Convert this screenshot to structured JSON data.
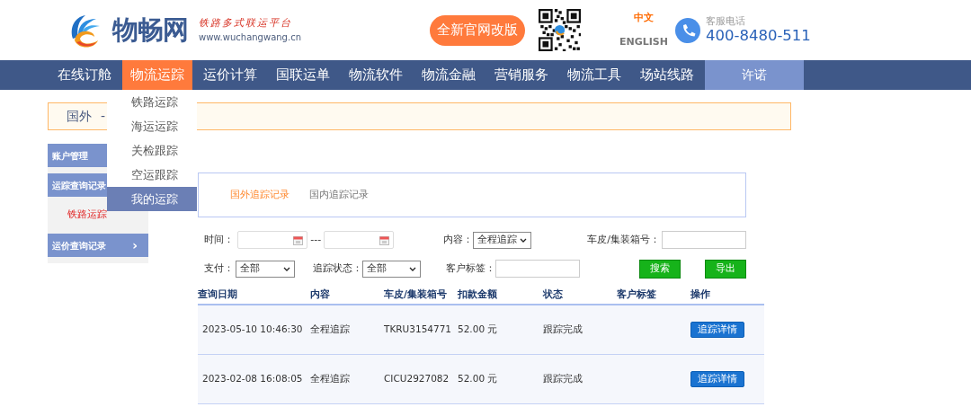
{
  "header": {
    "logo_text": "物畅网",
    "slogan": "铁路多式联运平台",
    "url": "www.wuchangwang.cn",
    "promo_button": "全新官网改版",
    "languages": [
      {
        "label": "中文",
        "selected": true
      },
      {
        "label": "ENGLISH",
        "selected": false
      }
    ],
    "phone_label": "客服电话",
    "phone_number": "400-8480-511"
  },
  "nav": {
    "items": [
      {
        "label": "在线订舱",
        "selected": false
      },
      {
        "label": "物流运踪",
        "selected": true
      },
      {
        "label": "运价计算",
        "selected": false
      },
      {
        "label": "国联运单",
        "selected": false
      },
      {
        "label": "物流软件",
        "selected": false
      },
      {
        "label": "物流金融",
        "selected": false
      },
      {
        "label": "营销服务",
        "selected": false
      },
      {
        "label": "物流工具",
        "selected": false
      },
      {
        "label": "场站线路",
        "selected": false
      }
    ],
    "right_item": "许诺"
  },
  "dropdown": [
    {
      "label": "铁路运踪",
      "selected": false
    },
    {
      "label": "海运运踪",
      "selected": false
    },
    {
      "label": "关检跟踪",
      "selected": false
    },
    {
      "label": "空运跟踪",
      "selected": false
    },
    {
      "label": "我的运踪",
      "selected": true
    }
  ],
  "breadcrumb": {
    "region": "国外",
    "separator": "-"
  },
  "sidebar": [
    {
      "label": "账户管理"
    },
    {
      "label": "运踪查询记录",
      "children": [
        {
          "label": "铁路运踪",
          "selected": true
        }
      ]
    },
    {
      "label": "运价查询记录",
      "arrow": "›"
    }
  ],
  "tabs": [
    {
      "label": "国外追踪记录",
      "selected": true
    },
    {
      "label": "国内追踪记录",
      "selected": false
    }
  ],
  "filters": {
    "time_label": "时间：",
    "range_separator": "---",
    "content_label": "内容：",
    "content_value": "全程追踪",
    "container_label": "车皮/集装箱号：",
    "pay_label": "支付：",
    "pay_value": "全部",
    "status_label": "追踪状态：",
    "status_value": "全部",
    "tag_label": "客户标签：",
    "search_button": "搜索",
    "export_button": "导出"
  },
  "table": {
    "columns": [
      "查询日期",
      "内容",
      "车皮/集装箱号",
      "扣款金额",
      "状态",
      "客户标签",
      "操作"
    ],
    "rows": [
      {
        "date": "2023-05-10 10:46:30",
        "content": "全程追踪",
        "container": "TKRU3154771",
        "amount": "52.00 元",
        "status": "跟踪完成",
        "action": "追踪详情"
      },
      {
        "date": "2023-02-08 16:08:05",
        "content": "全程追踪",
        "container": "CICU2927082",
        "amount": "52.00 元",
        "status": "跟踪完成",
        "action": "追踪详情"
      }
    ]
  }
}
